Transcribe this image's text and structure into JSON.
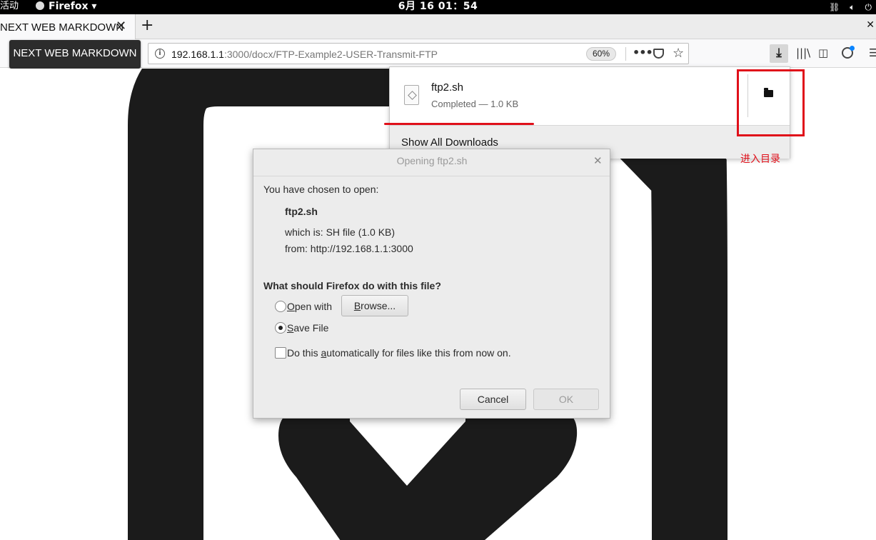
{
  "topbar": {
    "activities": "活动",
    "app_menu": "Firefox ▾",
    "clock": "6月 16  01：54"
  },
  "tabs": [
    {
      "title": "NEXT WEB MARKDOWN",
      "close": "✕"
    }
  ],
  "new_tab": "+",
  "tooltip": "NEXT WEB MARKDOWN",
  "urlbar": {
    "host": "192.168.1.1",
    "rest": ":3000/docx/FTP-Example2-USER-Transmit-FTP",
    "zoom": "60%",
    "more": "•••",
    "bookmark": "☆"
  },
  "downloads": {
    "file_name": "ftp2.sh",
    "status": "Completed — 1.0 KB",
    "show_all": "Show All Downloads"
  },
  "annotation": {
    "note": "进入目录",
    "accent": "#e0101a"
  },
  "dialog": {
    "title": "Opening ftp2.sh",
    "chosen": "You have chosen to open:",
    "file": "ftp2.sh",
    "which_is": "which is: SH file (1.0 KB)",
    "from": "from: http://192.168.1.1:3000",
    "question": "What should Firefox do with this file?",
    "open_with": "pen with",
    "open_with_key": "O",
    "browse": "rowse...",
    "browse_key": "B",
    "save_file": "ave File",
    "save_file_key": "S",
    "auto_pre": "Do this ",
    "auto_key": "a",
    "auto_post": "utomatically for files like this from now on.",
    "cancel": "Cancel",
    "ok": "OK",
    "selected_option": "Save File"
  }
}
